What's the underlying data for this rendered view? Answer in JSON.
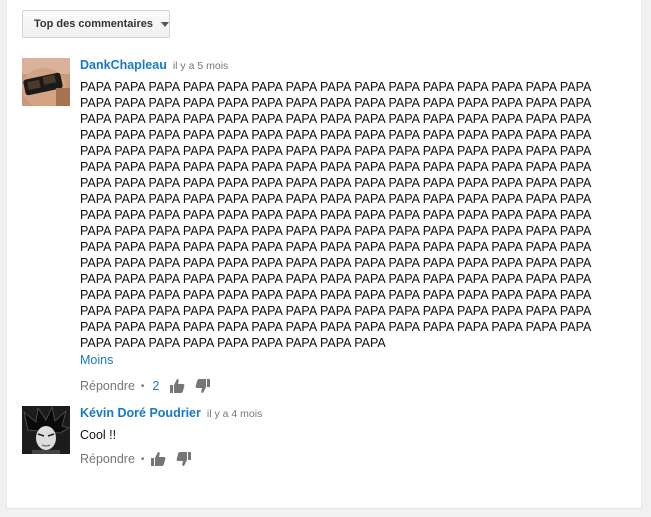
{
  "sort": {
    "label": "Top des commentaires"
  },
  "comments": [
    {
      "author": "DankChapleau",
      "time": "il y a 5 mois",
      "text": "PAPA PAPA PAPA PAPA PAPA PAPA PAPA PAPA PAPA PAPA PAPA PAPA PAPA PAPA PAPA PAPA PAPA PAPA PAPA PAPA PAPA PAPA PAPA PAPA PAPA PAPA PAPA PAPA PAPA PAPA PAPA PAPA PAPA PAPA PAPA PAPA PAPA PAPA PAPA PAPA PAPA PAPA PAPA PAPA PAPA PAPA PAPA PAPA PAPA PAPA PAPA PAPA PAPA PAPA PAPA PAPA PAPA PAPA PAPA PAPA PAPA PAPA PAPA PAPA PAPA PAPA PAPA PAPA PAPA PAPA PAPA PAPA PAPA PAPA PAPA PAPA PAPA PAPA PAPA PAPA PAPA PAPA PAPA PAPA PAPA PAPA PAPA PAPA PAPA PAPA PAPA PAPA PAPA PAPA PAPA PAPA PAPA PAPA PAPA PAPA PAPA PAPA PAPA PAPA PAPA PAPA PAPA PAPA PAPA PAPA PAPA PAPA PAPA PAPA PAPA PAPA PAPA PAPA PAPA PAPA PAPA PAPA PAPA PAPA PAPA PAPA PAPA PAPA PAPA PAPA PAPA PAPA PAPA PAPA PAPA PAPA PAPA PAPA PAPA PAPA PAPA PAPA PAPA PAPA PAPA PAPA PAPA PAPA PAPA PAPA PAPA PAPA PAPA PAPA PAPA PAPA PAPA PAPA PAPA PAPA PAPA PAPA PAPA PAPA PAPA PAPA PAPA PAPA PAPA PAPA PAPA PAPA PAPA PAPA PAPA PAPA PAPA PAPA PAPA PAPA PAPA PAPA PAPA PAPA PAPA PAPA PAPA PAPA PAPA PAPA PAPA PAPA PAPA PAPA PAPA PAPA PAPA PAPA PAPA PAPA PAPA PAPA PAPA PAPA PAPA PAPA PAPA PAPA PAPA PAPA PAPA PAPA PAPA PAPA PAPA PAPA PAPA PAPA PAPA PAPA PAPA PAPA PAPA PAPA PAPA PAPA PAPA PAPA PAPA PAPA PAPA PAPA PAPA PAPA PAPA PAPA PAPA PAPA PAPA PAPA PAPA PAPA PAPA PAPA PAPA PAPA PAPA PAPA PAPA",
      "more_label": "Moins",
      "reply_label": "Répondre",
      "separator": "•",
      "likes": "2"
    },
    {
      "author": "Kévin Doré Poudrier",
      "time": "il y a 4 mois",
      "text": "Cool !!",
      "reply_label": "Répondre",
      "separator": "•"
    }
  ],
  "colors": {
    "link": "#167ac6",
    "meta": "#767676"
  },
  "icons": [
    "thumb-up-icon",
    "thumb-down-icon",
    "caret-down-icon"
  ]
}
